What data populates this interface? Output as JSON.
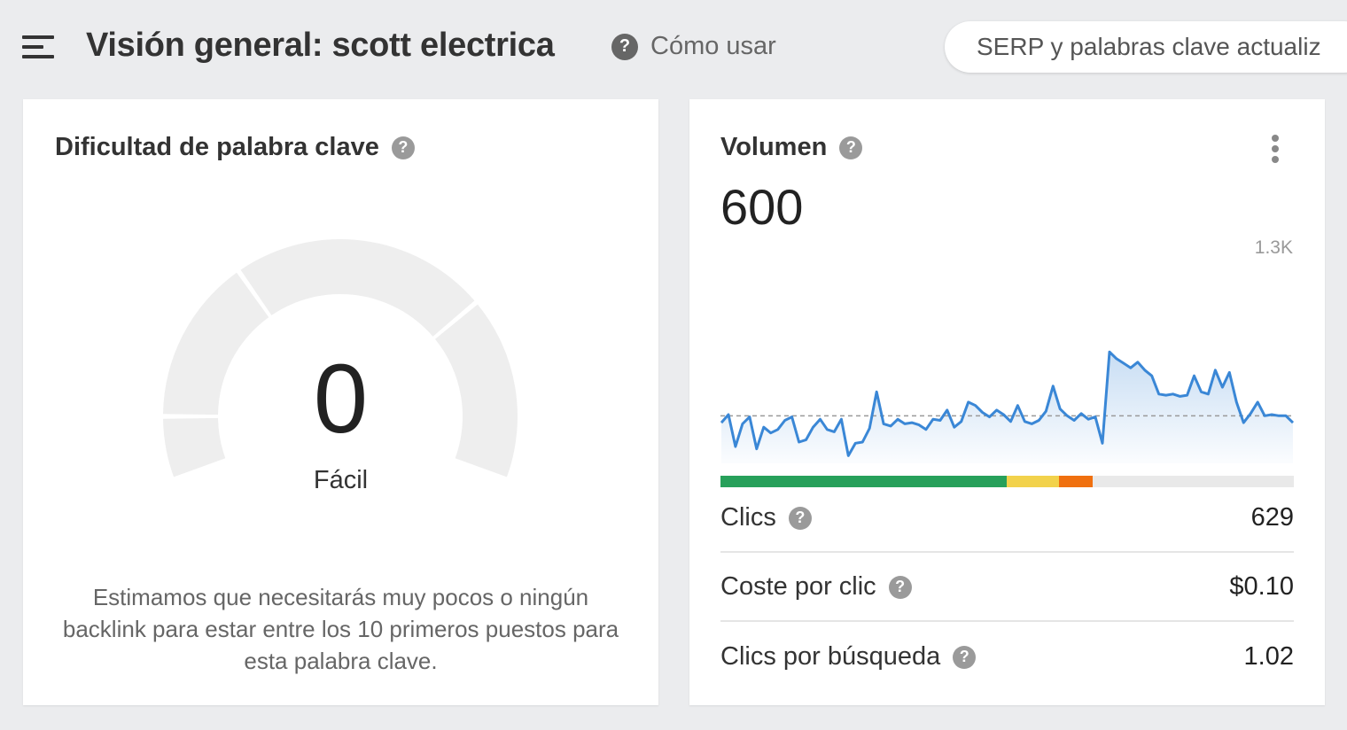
{
  "header": {
    "title": "Visión general: scott electrica",
    "how_to_label": "Cómo usar",
    "serp_notice": "SERP y palabras clave actualiz"
  },
  "kd_card": {
    "title": "Dificultad de palabra clave",
    "value": "0",
    "level": "Fácil",
    "description": "Estimamos que necesitarás muy pocos o ningún backlink para estar entre los 10 primeros puestos para esta palabra clave.",
    "gauge_fill_fraction": 0
  },
  "volume_card": {
    "title": "Volumen",
    "value": "600",
    "chart_max_label": "1.3K",
    "distribution": [
      {
        "color": "#27a05a",
        "share": 0.499
      },
      {
        "color": "#f2d24b",
        "share": 0.091
      },
      {
        "color": "#f0700f",
        "share": 0.059
      }
    ],
    "stats": [
      {
        "label": "Clics",
        "value": "629"
      },
      {
        "label": "Coste por clic",
        "value": "$0.10"
      },
      {
        "label": "Clics por búsqueda",
        "value": "1.02"
      }
    ]
  },
  "colors": {
    "accent_line": "#3a87d6",
    "gauge_track": "#eeeeee"
  },
  "chart_data": {
    "type": "area",
    "title": "",
    "ylabel": "",
    "ylim": [
      0,
      1300
    ],
    "average": 600,
    "values": [
      540,
      610,
      330,
      530,
      590,
      310,
      500,
      450,
      480,
      560,
      590,
      370,
      390,
      500,
      570,
      480,
      460,
      570,
      250,
      360,
      370,
      490,
      810,
      530,
      510,
      570,
      530,
      540,
      520,
      480,
      570,
      560,
      650,
      500,
      550,
      720,
      690,
      630,
      590,
      650,
      610,
      550,
      690,
      550,
      530,
      560,
      640,
      860,
      660,
      600,
      560,
      620,
      570,
      590,
      360,
      1160,
      1100,
      1060,
      1020,
      1070,
      1000,
      950,
      790,
      780,
      790,
      770,
      780,
      950,
      810,
      790,
      1000,
      850,
      980,
      720,
      540,
      620,
      720,
      600,
      610,
      600,
      600,
      540
    ]
  }
}
